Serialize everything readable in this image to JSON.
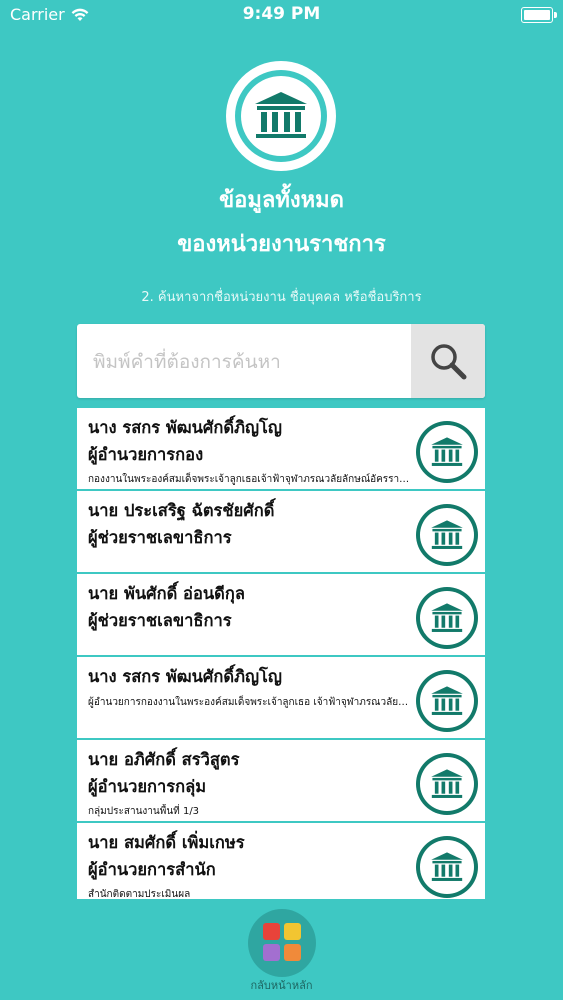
{
  "status_bar": {
    "carrier": "Carrier",
    "time": "9:49 PM"
  },
  "header": {
    "title_line1": "ข้อมูลทั้งหมด",
    "title_line2": "ของหน่วยงานราชการ",
    "subtitle": "2. ค้นหาจากชื่อหน่วยงาน ชื่อบุคคล หรือชื่อบริการ"
  },
  "search": {
    "placeholder": "พิมพ์คำที่ต้องการค้นหา",
    "value": ""
  },
  "results": [
    {
      "name": "นาง รสกร พัฒนศักดิ์ภิญโญ",
      "role": "ผู้อำนวยการกอง",
      "detail": "กองงานในพระองค์สมเด็จพระเจ้าลูกเธอเจ้าฟ้าจุฬาภรณวลัยลักษณ์อัครราชกุมารี"
    },
    {
      "name": "นาย ประเสริฐ ฉัตรชัยศักดิ์",
      "role": "ผู้ช่วยราชเลขาธิการ",
      "detail": ""
    },
    {
      "name": "นาย พันศักดิ์ อ่อนดีกุล",
      "role": "ผู้ช่วยราชเลขาธิการ",
      "detail": ""
    },
    {
      "name": "นาง รสกร พัฒนศักดิ์ภิญโญ",
      "role": "",
      "detail": "ผู้อำนวยการกองงานในพระองค์สมเด็จพระเจ้าลูกเธอ เจ้าฟ้าจุฬาภรณวลัยลักษณ์"
    },
    {
      "name": "นาย อภิศักดิ์ สรวิสูตร",
      "role": "ผู้อำนวยการกลุ่ม",
      "detail": "กลุ่มประสานงานพื้นที่ 1/3"
    },
    {
      "name": "นาย สมศักดิ์ เพิ่มเกษร",
      "role": "ผู้อำนวยการสำนัก",
      "detail": "สำนักติดตามประเมินผล"
    }
  ],
  "footer": {
    "home_label": "กลับหน้าหลัก"
  },
  "colors": {
    "background": "#3ec8c3",
    "icon": "#127a6a",
    "accent": "#2fa6a1"
  },
  "icons": {
    "logo": "government-building-icon",
    "search": "search-icon",
    "item": "government-building-icon",
    "home": "home-grid-icon"
  }
}
